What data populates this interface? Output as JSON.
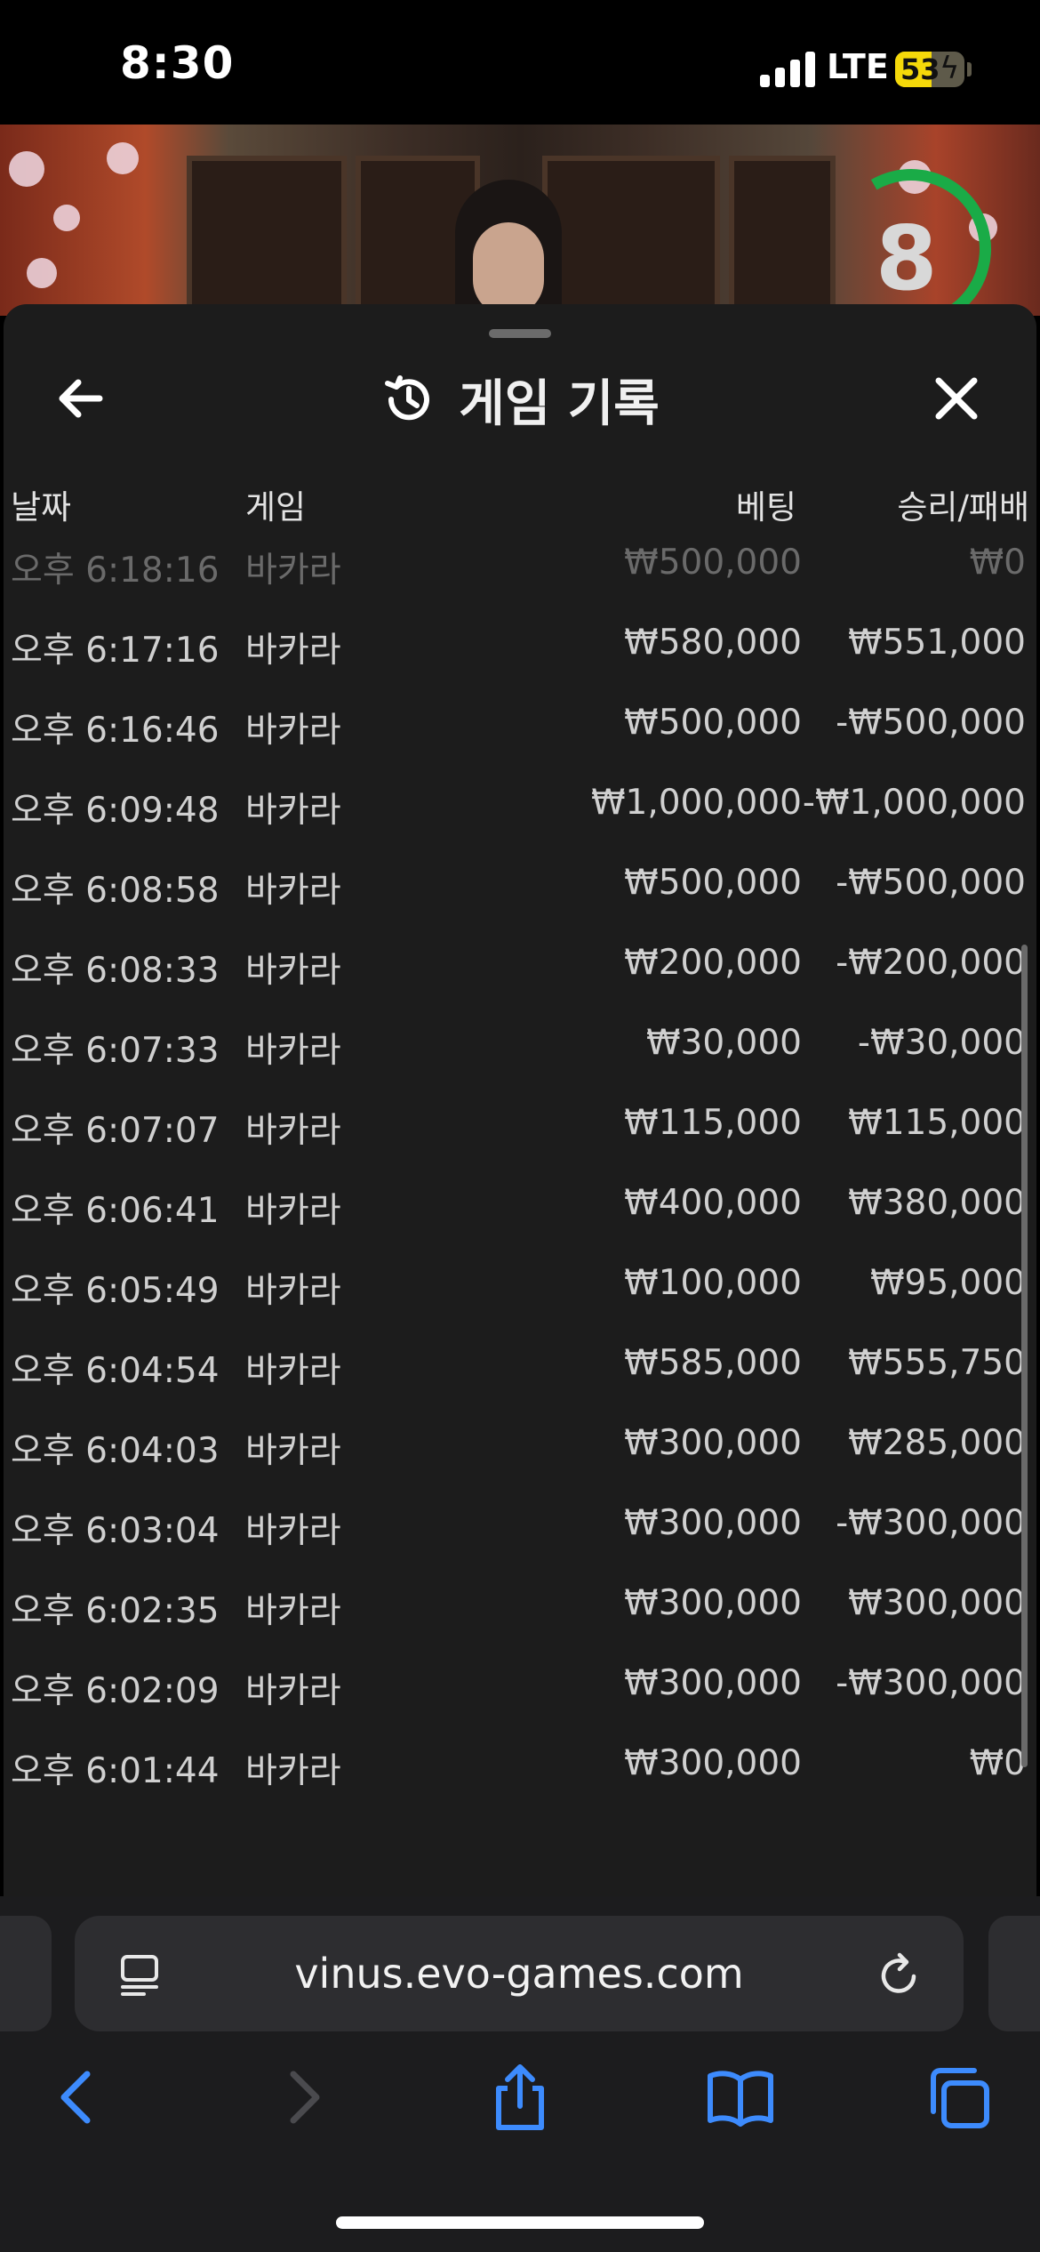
{
  "status_bar": {
    "time": "8:30",
    "network": "LTE",
    "battery_percent": "53",
    "battery_level": 0.53,
    "charging": true
  },
  "video": {
    "countdown": "8",
    "countdown_ring_color": "#1aab47"
  },
  "panel": {
    "title": "게임 기록",
    "columns": {
      "date": "날짜",
      "game": "게임",
      "bet": "베팅",
      "result": "승리/패배"
    },
    "rows": [
      {
        "date": "오후 6:18:16",
        "game": "바카라",
        "bet": "₩500,000",
        "result": "₩0"
      },
      {
        "date": "오후 6:17:16",
        "game": "바카라",
        "bet": "₩580,000",
        "result": "₩551,000"
      },
      {
        "date": "오후 6:16:46",
        "game": "바카라",
        "bet": "₩500,000",
        "result": "-₩500,000"
      },
      {
        "date": "오후 6:09:48",
        "game": "바카라",
        "bet": "₩1,000,000",
        "result": "-₩1,000,000"
      },
      {
        "date": "오후 6:08:58",
        "game": "바카라",
        "bet": "₩500,000",
        "result": "-₩500,000"
      },
      {
        "date": "오후 6:08:33",
        "game": "바카라",
        "bet": "₩200,000",
        "result": "-₩200,000"
      },
      {
        "date": "오후 6:07:33",
        "game": "바카라",
        "bet": "₩30,000",
        "result": "-₩30,000"
      },
      {
        "date": "오후 6:07:07",
        "game": "바카라",
        "bet": "₩115,000",
        "result": "₩115,000"
      },
      {
        "date": "오후 6:06:41",
        "game": "바카라",
        "bet": "₩400,000",
        "result": "₩380,000"
      },
      {
        "date": "오후 6:05:49",
        "game": "바카라",
        "bet": "₩100,000",
        "result": "₩95,000"
      },
      {
        "date": "오후 6:04:54",
        "game": "바카라",
        "bet": "₩585,000",
        "result": "₩555,750"
      },
      {
        "date": "오후 6:04:03",
        "game": "바카라",
        "bet": "₩300,000",
        "result": "₩285,000"
      },
      {
        "date": "오후 6:03:04",
        "game": "바카라",
        "bet": "₩300,000",
        "result": "-₩300,000"
      },
      {
        "date": "오후 6:02:35",
        "game": "바카라",
        "bet": "₩300,000",
        "result": "₩300,000"
      },
      {
        "date": "오후 6:02:09",
        "game": "바카라",
        "bet": "₩300,000",
        "result": "-₩300,000"
      },
      {
        "date": "오후 6:01:44",
        "game": "바카라",
        "bet": "₩300,000",
        "result": "₩0"
      }
    ]
  },
  "browser": {
    "url": "vinus.evo-games.com",
    "accent_color": "#3d8bfd"
  }
}
